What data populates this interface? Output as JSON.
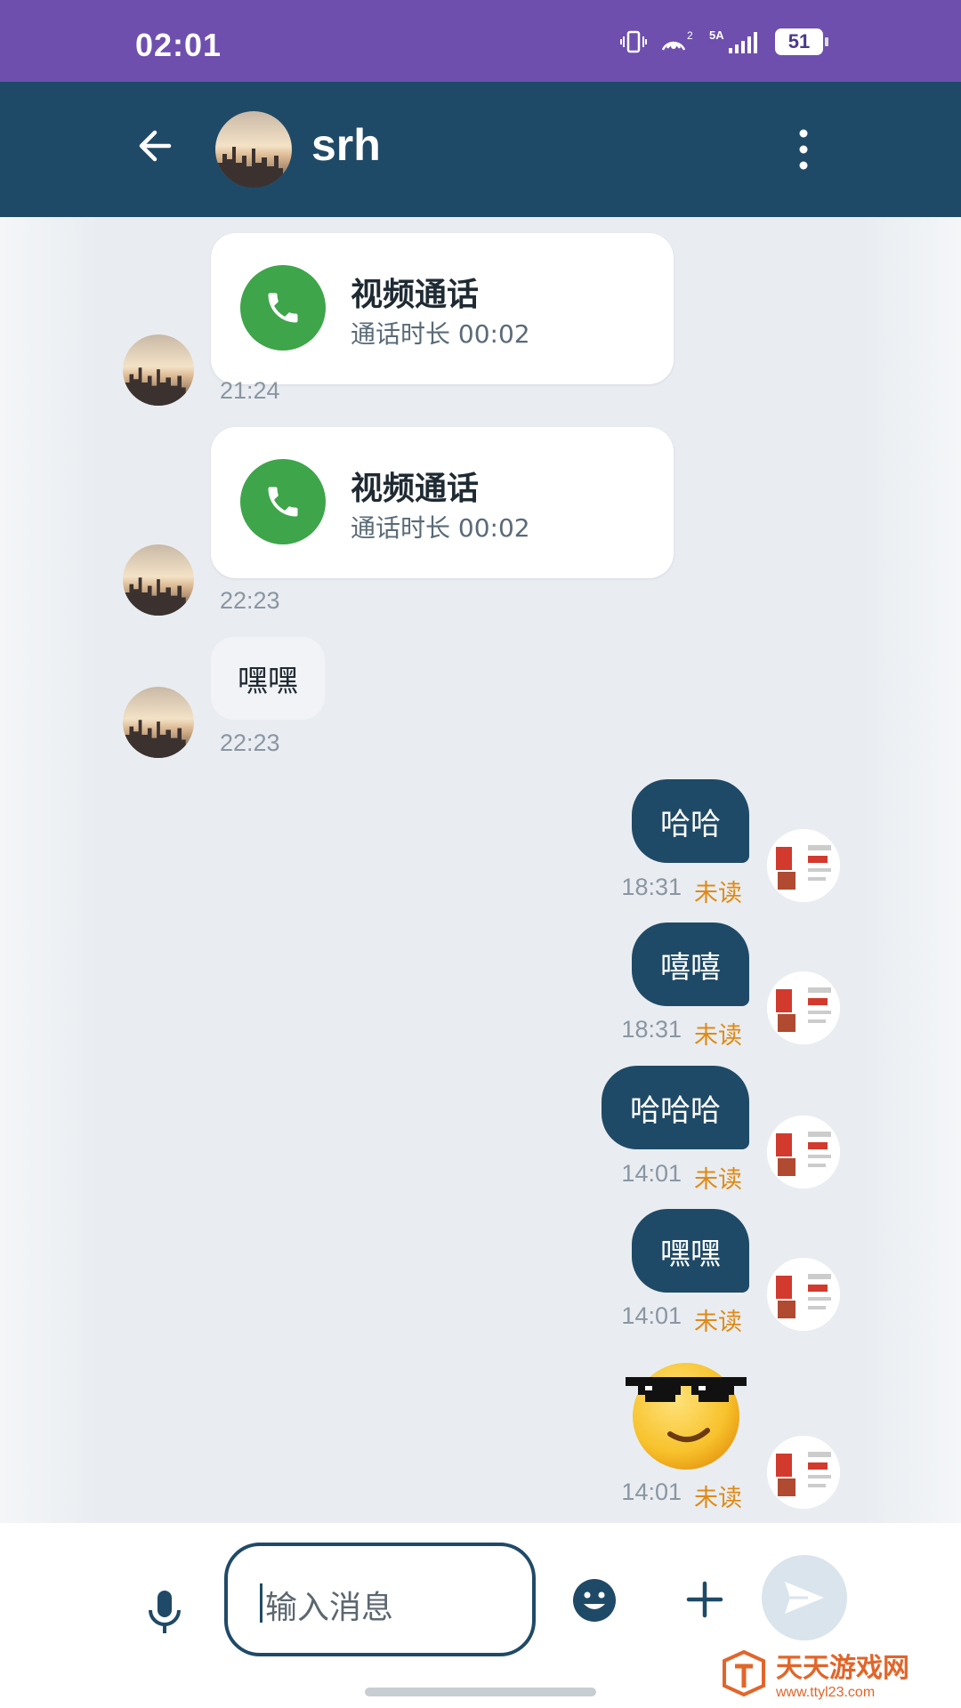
{
  "status_bar": {
    "time": "02:01",
    "battery": "51",
    "network": "5A"
  },
  "header": {
    "contact_name": "srh"
  },
  "messages_in": [
    {
      "type": "video_call",
      "title": "视频通话",
      "duration": "通话时长 00:02",
      "time": "21:24"
    },
    {
      "type": "video_call",
      "title": "视频通话",
      "duration": "通话时长 00:02",
      "time": "22:23"
    },
    {
      "type": "text",
      "text": "嘿嘿",
      "time": "22:23"
    }
  ],
  "messages_out": [
    {
      "text": "哈哈",
      "time": "18:31",
      "status": "未读"
    },
    {
      "text": "嘻嘻",
      "time": "18:31",
      "status": "未读"
    },
    {
      "text": "哈哈哈",
      "time": "14:01",
      "status": "未读"
    },
    {
      "text": "嘿嘿",
      "time": "14:01",
      "status": "未读"
    },
    {
      "type": "emoji",
      "emoji": "cool-sunglasses-emoji",
      "time": "14:01",
      "status": "未读"
    }
  ],
  "input": {
    "placeholder": "输入消息"
  },
  "watermark": {
    "name": "天天游戏网",
    "url": "www.ttyl23.com"
  },
  "colors": {
    "status_bar": "#6e4fae",
    "app_bar": "#1f4a67",
    "outgoing_bubble": "#1f4a67",
    "call_icon": "#3ea54a",
    "unread": "#e08a16"
  }
}
